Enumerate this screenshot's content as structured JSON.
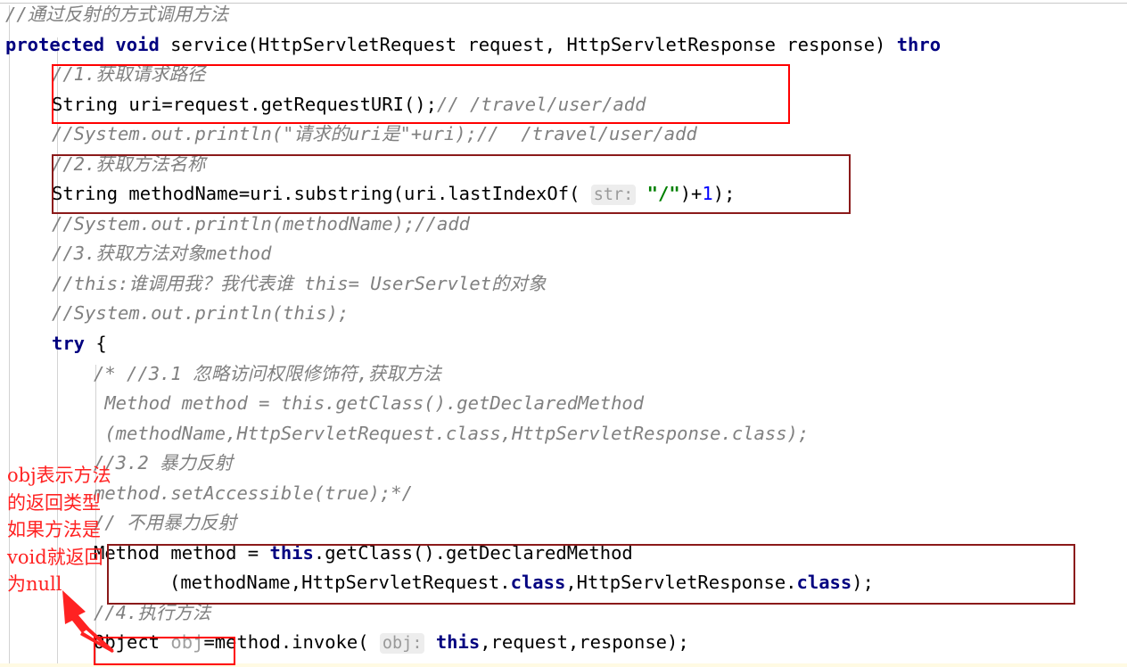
{
  "app": {
    "kind": "java-code-editor",
    "language": "Java",
    "theme": "light"
  },
  "colors": {
    "background": "#ffffff",
    "text": "#000000",
    "comment": "#808080",
    "keyword": "#000080",
    "string": "#008000",
    "number": "#0000ff",
    "param_hint_text": "#9a9a9a",
    "param_hint_bg": "#ededed",
    "annotation_red": "#ff2222",
    "box_bright_red": "#ff0000",
    "box_dark_red": "#8b1a1a",
    "guide_line": "#d3d3d3",
    "current_line_highlight": "#fffae3"
  },
  "code_lines": [
    {
      "indent": 0,
      "segments": [
        {
          "t": "//通过反射的方式调用方法",
          "c": "cmt"
        }
      ]
    },
    {
      "indent": 0,
      "segments": [
        {
          "t": "protected void ",
          "c": "kw"
        },
        {
          "t": "service(HttpServletRequest request, HttpServletResponse response) ",
          "c": ""
        },
        {
          "t": "thro",
          "c": "kw"
        }
      ]
    },
    {
      "indent": 1,
      "segments": [
        {
          "t": "//1.获取请求路径",
          "c": "cmt"
        }
      ]
    },
    {
      "indent": 1,
      "segments": [
        {
          "t": "String uri=request.getRequestURI();",
          "c": ""
        },
        {
          "t": "// /travel/user/add",
          "c": "cmt"
        }
      ]
    },
    {
      "indent": 1,
      "segments": [
        {
          "t": "//System.out.println(\"请求的uri是\"+uri);//  /travel/user/add",
          "c": "cmt"
        }
      ]
    },
    {
      "indent": 1,
      "segments": [
        {
          "t": "//2.获取方法名称",
          "c": "cmt"
        }
      ]
    },
    {
      "indent": 1,
      "segments": [
        {
          "t": "String methodName=uri.substring(uri.lastIndexOf( ",
          "c": ""
        },
        {
          "t": "str:",
          "c": "hint"
        },
        {
          "t": " ",
          "c": ""
        },
        {
          "t": "\"/\"",
          "c": "str"
        },
        {
          "t": ")+",
          "c": ""
        },
        {
          "t": "1",
          "c": "num"
        },
        {
          "t": ");",
          "c": ""
        }
      ]
    },
    {
      "indent": 1,
      "segments": [
        {
          "t": "//System.out.println(methodName);//add",
          "c": "cmt"
        }
      ]
    },
    {
      "indent": 1,
      "segments": [
        {
          "t": "//3.获取方法对象method",
          "c": "cmt"
        }
      ]
    },
    {
      "indent": 1,
      "segments": [
        {
          "t": "//this:谁调用我？我代表谁 this= UserServlet的对象",
          "c": "cmt"
        }
      ]
    },
    {
      "indent": 1,
      "segments": [
        {
          "t": "//System.out.println(this);",
          "c": "cmt"
        }
      ]
    },
    {
      "indent": 1,
      "segments": [
        {
          "t": "try ",
          "c": "kw"
        },
        {
          "t": "{",
          "c": ""
        }
      ]
    },
    {
      "indent": 2,
      "segments": [
        {
          "t": "/* //3.1 忽略访问权限修饰符,获取方法",
          "c": "cmt"
        }
      ]
    },
    {
      "indent": 2,
      "segments": [
        {
          "t": " Method method = this.getClass().getDeclaredMethod",
          "c": "cmt"
        }
      ]
    },
    {
      "indent": 2,
      "segments": [
        {
          "t": " (methodName,HttpServletRequest.class,HttpServletResponse.class);",
          "c": "cmt"
        }
      ]
    },
    {
      "indent": 2,
      "segments": [
        {
          "t": "//3.2 暴力反射",
          "c": "cmt"
        }
      ]
    },
    {
      "indent": 2,
      "segments": [
        {
          "t": "method.setAccessible(true);*/",
          "c": "cmt"
        }
      ]
    },
    {
      "indent": 2,
      "segments": [
        {
          "t": "// 不用暴力反射",
          "c": "cmt"
        }
      ]
    },
    {
      "indent": 2,
      "segments": [
        {
          "t": "Method method = ",
          "c": ""
        },
        {
          "t": "this",
          "c": "kw"
        },
        {
          "t": ".getClass().getDeclaredMethod",
          "c": ""
        }
      ]
    },
    {
      "indent": 4,
      "segments": [
        {
          "t": "(methodName,HttpServletRequest.",
          "c": ""
        },
        {
          "t": "class",
          "c": "kw"
        },
        {
          "t": ",HttpServletResponse.",
          "c": ""
        },
        {
          "t": "class",
          "c": "kw"
        },
        {
          "t": ");",
          "c": ""
        }
      ]
    },
    {
      "indent": 2,
      "segments": [
        {
          "t": "//4.执行方法",
          "c": "cmt"
        }
      ]
    },
    {
      "indent": 2,
      "segments": [
        {
          "t": "Object ",
          "c": ""
        },
        {
          "t": "obj",
          "c": "dim"
        },
        {
          "t": "=method.invoke( ",
          "c": ""
        },
        {
          "t": "obj:",
          "c": "hint"
        },
        {
          "t": " ",
          "c": ""
        },
        {
          "t": "this",
          "c": "kw"
        },
        {
          "t": ",request,response);",
          "c": ""
        }
      ]
    }
  ],
  "annotation": {
    "lines": [
      "obj表示方法",
      "的返回类型",
      "如果方法是",
      "void就返回",
      "为null"
    ],
    "arrow": "red-arrow-up-left"
  },
  "highlight_boxes": [
    {
      "name": "box-get-request-path",
      "color": "#ff0000",
      "covers": "//1.获取请求路径 + String uri=request.getRequestURI();"
    },
    {
      "name": "box-get-method-name",
      "color": "#8b1a1a",
      "covers": "//2.获取方法名称 + String methodName=uri.substring(...)"
    },
    {
      "name": "box-get-declared-method",
      "color": "#8b1a1a",
      "covers": "Method method = this.getClass().getDeclaredMethod(...)"
    },
    {
      "name": "box-object-obj",
      "color": "#ff0000",
      "covers": "Object obj"
    }
  ]
}
